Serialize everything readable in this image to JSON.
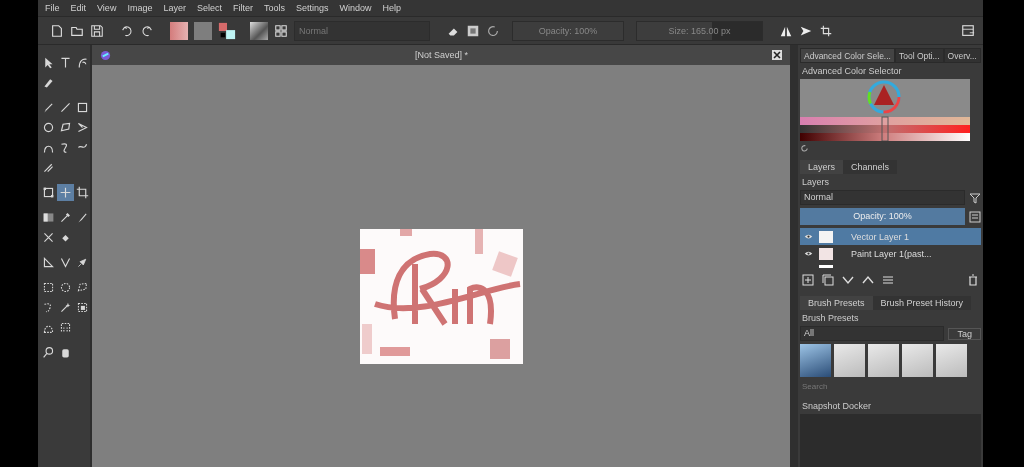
{
  "menu": [
    "File",
    "Edit",
    "View",
    "Image",
    "Layer",
    "Select",
    "Filter",
    "Tools",
    "Settings",
    "Window",
    "Help"
  ],
  "toolbar": {
    "blend_mode": "Normal",
    "opacity": {
      "label": "Opacity: 100%",
      "level": 1
    },
    "size": {
      "label": "Size: 165.00 px",
      "level": 0.6
    }
  },
  "toolbox": {
    "groups": [
      {
        "tools": [
          {
            "kind": "pointer",
            "selected": false
          },
          {
            "kind": "text",
            "selected": false
          },
          {
            "kind": "calligraphy",
            "selected": false
          },
          {
            "kind": "pen",
            "selected": false
          }
        ]
      },
      {
        "tools": [
          {
            "kind": "brush",
            "selected": false
          },
          {
            "kind": "line",
            "selected": false
          },
          {
            "kind": "rect",
            "selected": false
          },
          {
            "kind": "ellipse",
            "selected": false
          },
          {
            "kind": "polygon",
            "selected": false
          },
          {
            "kind": "polyline",
            "selected": false
          },
          {
            "kind": "bezier",
            "selected": false
          },
          {
            "kind": "freehand",
            "selected": false
          },
          {
            "kind": "dynamic",
            "selected": false
          },
          {
            "kind": "multibrush",
            "selected": false
          }
        ]
      },
      {
        "tools": [
          {
            "kind": "transform",
            "selected": false
          },
          {
            "kind": "move",
            "selected": true
          },
          {
            "kind": "crop",
            "selected": false
          }
        ]
      },
      {
        "tools": [
          {
            "kind": "gradient",
            "selected": false
          },
          {
            "kind": "eyedropper",
            "selected": false
          },
          {
            "kind": "colorize",
            "selected": false
          },
          {
            "kind": "patch",
            "selected": false
          },
          {
            "kind": "fill",
            "selected": false
          }
        ]
      },
      {
        "tools": [
          {
            "kind": "assistant",
            "selected": false
          },
          {
            "kind": "measure",
            "selected": false
          },
          {
            "kind": "pin",
            "selected": false
          }
        ]
      },
      {
        "tools": [
          {
            "kind": "rectsel",
            "selected": false
          },
          {
            "kind": "ellsel",
            "selected": false
          },
          {
            "kind": "polysel",
            "selected": false
          },
          {
            "kind": "freesel",
            "selected": false
          },
          {
            "kind": "wand",
            "selected": false
          },
          {
            "kind": "similar",
            "selected": false
          },
          {
            "kind": "beziersel",
            "selected": false
          },
          {
            "kind": "magnetic",
            "selected": false
          }
        ]
      },
      {
        "tools": [
          {
            "kind": "zoom",
            "selected": false
          },
          {
            "kind": "pan",
            "selected": false
          }
        ]
      }
    ]
  },
  "document": {
    "title": "[Not Saved] *"
  },
  "docker": {
    "tabs": [
      {
        "label": "Advanced Color Sele...",
        "selected": true
      },
      {
        "label": "Tool Opti...",
        "selected": false
      },
      {
        "label": "Overv...",
        "selected": false
      }
    ],
    "color_selector_title": "Advanced Color Selector",
    "layer_tabs": [
      {
        "label": "Layers",
        "selected": true
      },
      {
        "label": "Channels",
        "selected": false
      }
    ],
    "layers": {
      "title": "Layers",
      "blend_mode": "Normal",
      "opacity": {
        "label": "Opacity:  100%",
        "level": 1
      },
      "rows": [
        {
          "name": "Vector Layer 1",
          "kind": "vector",
          "selected": true
        },
        {
          "name": "Paint Layer 1(past...",
          "kind": "paint",
          "selected": false
        },
        {
          "kind": "background",
          "selected": false
        }
      ]
    },
    "brush_tabs": [
      {
        "label": "Brush Presets",
        "selected": true
      },
      {
        "label": "Brush Preset History",
        "selected": false
      }
    ],
    "brush_presets": {
      "title": "Brush Presets",
      "filter": "All",
      "tag": "Tag",
      "presets": [
        {
          "selected": true
        },
        {
          "selected": false
        },
        {
          "selected": false
        },
        {
          "selected": false
        },
        {
          "selected": false
        }
      ],
      "search_placeholder": "Search"
    },
    "snapshot": {
      "title": "Snapshot Docker"
    }
  }
}
